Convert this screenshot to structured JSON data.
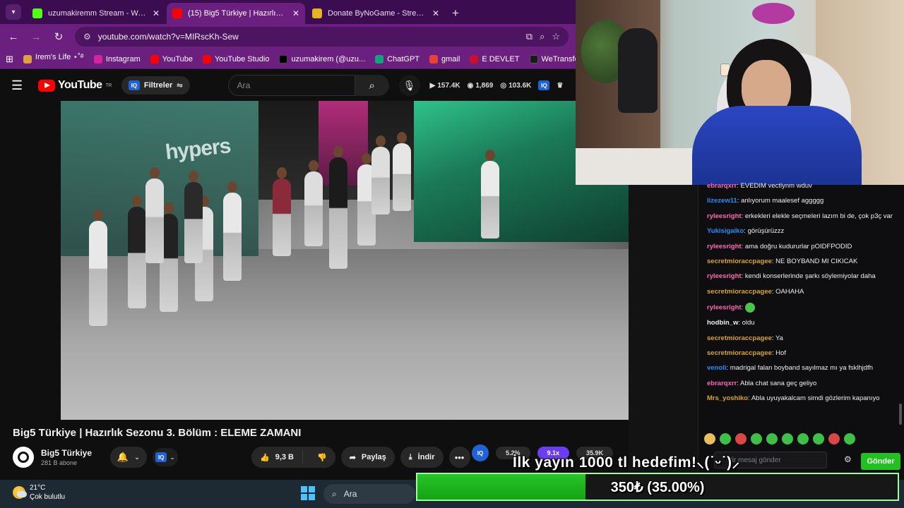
{
  "browser": {
    "tabs": [
      {
        "title": "uzumakiremm Stream - Watch Live on Kick",
        "favicon_color": "#53fc18",
        "active": false
      },
      {
        "title": "(15) Big5 Türkiye | Hazırlık Sezonu",
        "favicon_color": "#ff0000",
        "active": true
      },
      {
        "title": "Donate ByNoGame - Streamer",
        "favicon_color": "#e6b325",
        "active": false
      }
    ],
    "close_glyph": "✕",
    "new_tab_glyph": "+",
    "url": "youtube.com/watch?v=MIRscKh-Sew",
    "bookmarks": [
      {
        "label": "Irem's Life ⋆˚࿔",
        "color": "#e0a040"
      },
      {
        "label": "Instagram",
        "color": "#d6249f"
      },
      {
        "label": "YouTube",
        "color": "#ff0000"
      },
      {
        "label": "YouTube Studio",
        "color": "#ff0000"
      },
      {
        "label": "uzumakirem (@uzu...",
        "color": "#000000"
      },
      {
        "label": "ChatGPT",
        "color": "#10a37f"
      },
      {
        "label": "gmail",
        "color": "#ea4335"
      },
      {
        "label": "E DEVLET",
        "color": "#c8102e"
      },
      {
        "label": "WeTransfer",
        "color": "#1a1a1a"
      }
    ]
  },
  "youtube": {
    "logo_text": "YouTube",
    "region": "TR",
    "filters_label": "Filtreler",
    "iq_label": "IQ",
    "search_placeholder": "Ara",
    "stats": {
      "views": "157.4K",
      "eye": "1,869",
      "likes": "103.6K"
    },
    "video_sign": "hypers",
    "channel_badge": "5",
    "title": "Big5 Türkiye | Hazırlık Sezonu 3. Bölüm : ELEME ZAMANI",
    "channel_name": "Big5 Türkiye",
    "subscribers": "281 B abone",
    "like_count": "9,3 B",
    "share_label": "Paylaş",
    "download_label": "İndir",
    "iq_metrics": [
      "5.2%",
      "9.1x",
      "35.9K"
    ]
  },
  "chat": {
    "messages": [
      {
        "user": "ebrarqxrr",
        "text": "EVEDIM vectlynm wduv",
        "color": "#ff69b4"
      },
      {
        "user": "lizezew11",
        "text": "anlıyorum maalesef aggggg",
        "color": "#1e90ff"
      },
      {
        "user": "ryleesright",
        "text": "erkekleri elekle seçmeleri lazım bi de, çok p3ç var",
        "color": "#ff69b4"
      },
      {
        "user": "Yukisigaiko",
        "text": "görüşürüzzz",
        "color": "#1e90ff"
      },
      {
        "user": "ryleesright",
        "text": "ama doğru kudururlar pOIDFPODID",
        "color": "#ff69b4"
      },
      {
        "user": "secretmioraccpagee",
        "text": "NE BOYBAND MI CIKICAK",
        "color": "#daa520"
      },
      {
        "user": "ryleesright",
        "text": "kendi konserlerinde şarkı söylemiyolar daha",
        "color": "#ff69b4"
      },
      {
        "user": "secretmioraccpagee",
        "text": "OAHAHA",
        "color": "#daa520"
      },
      {
        "user": "ryleesright",
        "text": "",
        "color": "#ff69b4",
        "emote": true
      },
      {
        "user": "hodbin_w",
        "text": "oldu",
        "color": "#efeff1"
      },
      {
        "user": "secretmioraccpagee",
        "text": "Ya",
        "color": "#daa520"
      },
      {
        "user": "secretmioraccpagee",
        "text": "Hof",
        "color": "#daa520"
      },
      {
        "user": "venoli",
        "text": "madrigal falan boyband sayılmaz mı ya fsklhjdfh",
        "color": "#1e90ff"
      },
      {
        "user": "ebrarqxrr",
        "text": "Abla chat sana geç geliyo",
        "color": "#ff69b4"
      },
      {
        "user": "Mrs_yoshiko",
        "text": "Abla uyuyakalcam simdi gözlerim kapanıyo",
        "color": "#daa520"
      }
    ],
    "input_placeholder": "Bir mesaj gönder",
    "send_label": "Gönder"
  },
  "goal": {
    "title": "İlk yayın 1000 tl hedefim!⸜(˙ᵕ˙)⸝",
    "label": "350₺ (35.00%)",
    "progress": 0.35
  },
  "taskbar": {
    "temperature": "21°C",
    "condition": "Çok bulutlu",
    "search_label": "Ara"
  }
}
